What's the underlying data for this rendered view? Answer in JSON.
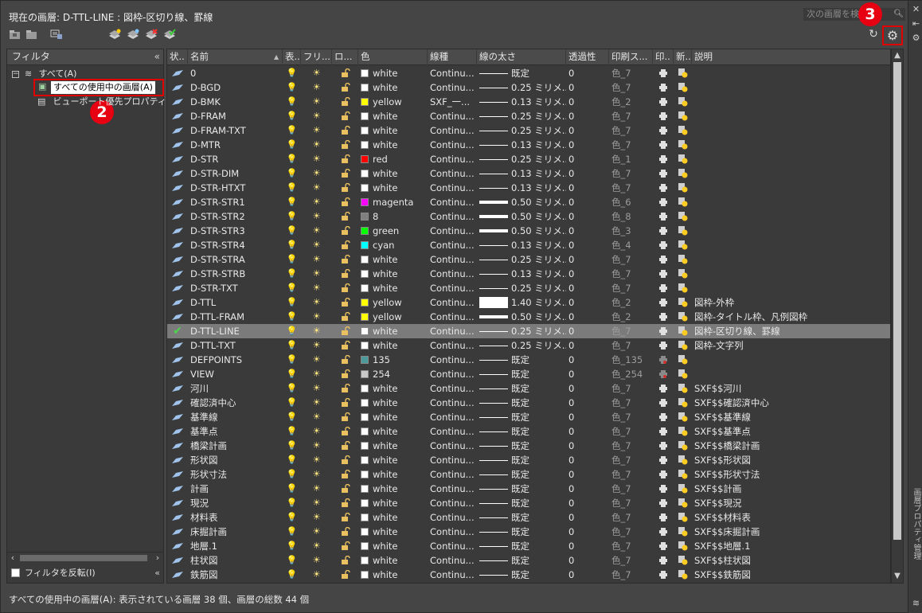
{
  "title": "現在の画層: D-TTL-LINE : 図枠-区切り線、罫線",
  "search_placeholder": "次の画層を検索",
  "callouts": {
    "two": "2",
    "three": "3"
  },
  "sidebar_strip_label": "画層プロパティ管理",
  "filter": {
    "header": "フィルタ",
    "tree": [
      {
        "label": "すべて(A)",
        "expander": "−"
      },
      {
        "label": "すべての使用中の画層(A)"
      },
      {
        "label": "ビューポート優先プロパティを含む画層"
      }
    ],
    "invert_label": "フィルタを反転(I)"
  },
  "columns": [
    "状..",
    "名前",
    "表..",
    "フリ...",
    "ロ...",
    "色",
    "線種",
    "線の太さ",
    "透過性",
    "印刷ス...",
    "印..",
    "新..",
    "説明"
  ],
  "sort_indicator": "▲",
  "colors": {
    "white": "#ffffff",
    "yellow": "#ffff00",
    "red": "#ff0000",
    "magenta": "#ff00ff",
    "8": "#808080",
    "green": "#00ff00",
    "cyan": "#00ffff",
    "135": "#4c9999",
    "254": "#c8c8c8"
  },
  "layers": [
    {
      "name": "0",
      "color": "white",
      "linetype": "Continu...",
      "lineweight": "既定",
      "lw": 1,
      "transparency": "0",
      "plotstyle": "色_7",
      "desc": ""
    },
    {
      "name": "D-BGD",
      "color": "white",
      "linetype": "Continu...",
      "lineweight": "0.25 ミリメ...",
      "lw": 1,
      "transparency": "0",
      "plotstyle": "色_7",
      "desc": ""
    },
    {
      "name": "D-BMK",
      "color": "yellow",
      "linetype": "SXF_一...",
      "lineweight": "0.13 ミリメ...",
      "lw": 1,
      "transparency": "0",
      "plotstyle": "色_2",
      "desc": ""
    },
    {
      "name": "D-FRAM",
      "color": "white",
      "linetype": "Continu...",
      "lineweight": "0.25 ミリメ...",
      "lw": 1,
      "transparency": "0",
      "plotstyle": "色_7",
      "desc": ""
    },
    {
      "name": "D-FRAM-TXT",
      "color": "white",
      "linetype": "Continu...",
      "lineweight": "0.25 ミリメ...",
      "lw": 1,
      "transparency": "0",
      "plotstyle": "色_7",
      "desc": ""
    },
    {
      "name": "D-MTR",
      "color": "white",
      "linetype": "Continu...",
      "lineweight": "0.13 ミリメ...",
      "lw": 1,
      "transparency": "0",
      "plotstyle": "色_7",
      "desc": ""
    },
    {
      "name": "D-STR",
      "color": "red",
      "linetype": "Continu...",
      "lineweight": "0.25 ミリメ...",
      "lw": 1,
      "transparency": "0",
      "plotstyle": "色_1",
      "desc": ""
    },
    {
      "name": "D-STR-DIM",
      "color": "white",
      "linetype": "Continu...",
      "lineweight": "0.13 ミリメ...",
      "lw": 1,
      "transparency": "0",
      "plotstyle": "色_7",
      "desc": ""
    },
    {
      "name": "D-STR-HTXT",
      "color": "white",
      "linetype": "Continu...",
      "lineweight": "0.13 ミリメ...",
      "lw": 1,
      "transparency": "0",
      "plotstyle": "色_7",
      "desc": ""
    },
    {
      "name": "D-STR-STR1",
      "color": "magenta",
      "linetype": "Continu...",
      "lineweight": "0.50 ミリメ...",
      "lw": 4,
      "transparency": "0",
      "plotstyle": "色_6",
      "desc": ""
    },
    {
      "name": "D-STR-STR2",
      "color": "8",
      "linetype": "Continu...",
      "lineweight": "0.50 ミリメ...",
      "lw": 4,
      "transparency": "0",
      "plotstyle": "色_8",
      "desc": ""
    },
    {
      "name": "D-STR-STR3",
      "color": "green",
      "linetype": "Continu...",
      "lineweight": "0.50 ミリメ...",
      "lw": 4,
      "transparency": "0",
      "plotstyle": "色_3",
      "desc": ""
    },
    {
      "name": "D-STR-STR4",
      "color": "cyan",
      "linetype": "Continu...",
      "lineweight": "0.13 ミリメ...",
      "lw": 1,
      "transparency": "0",
      "plotstyle": "色_4",
      "desc": ""
    },
    {
      "name": "D-STR-STRA",
      "color": "white",
      "linetype": "Continu...",
      "lineweight": "0.25 ミリメ...",
      "lw": 1,
      "transparency": "0",
      "plotstyle": "色_7",
      "desc": ""
    },
    {
      "name": "D-STR-STRB",
      "color": "white",
      "linetype": "Continu...",
      "lineweight": "0.13 ミリメ...",
      "lw": 1,
      "transparency": "0",
      "plotstyle": "色_7",
      "desc": ""
    },
    {
      "name": "D-STR-TXT",
      "color": "white",
      "linetype": "Continu...",
      "lineweight": "0.25 ミリメ...",
      "lw": 1,
      "transparency": "0",
      "plotstyle": "色_7",
      "desc": ""
    },
    {
      "name": "D-TTL",
      "color": "yellow",
      "linetype": "Continu...",
      "lineweight": "1.40 ミリメ...",
      "lw": 14,
      "transparency": "0",
      "plotstyle": "色_2",
      "desc": "図枠-外枠"
    },
    {
      "name": "D-TTL-FRAM",
      "color": "yellow",
      "linetype": "Continu...",
      "lineweight": "0.50 ミリメ...",
      "lw": 4,
      "transparency": "0",
      "plotstyle": "色_2",
      "desc": "図枠-タイトル枠、凡例図枠"
    },
    {
      "name": "D-TTL-LINE",
      "color": "white",
      "linetype": "Continu...",
      "lineweight": "0.25 ミリメ...",
      "lw": 1,
      "transparency": "0",
      "plotstyle": "色_7",
      "desc": "図枠-区切り線、罫線",
      "current": true
    },
    {
      "name": "D-TTL-TXT",
      "color": "white",
      "linetype": "Continu...",
      "lineweight": "0.25 ミリメ...",
      "lw": 1,
      "transparency": "0",
      "plotstyle": "色_7",
      "desc": "図枠-文字列"
    },
    {
      "name": "DEFPOINTS",
      "color": "135",
      "linetype": "Continu...",
      "lineweight": "既定",
      "lw": 1,
      "transparency": "0",
      "plotstyle": "色_135",
      "desc": "",
      "noplot": true
    },
    {
      "name": "VIEW",
      "color": "254",
      "linetype": "Continu...",
      "lineweight": "既定",
      "lw": 1,
      "transparency": "0",
      "plotstyle": "色_254",
      "desc": "",
      "noplot": true
    },
    {
      "name": "河川",
      "color": "white",
      "linetype": "Continu...",
      "lineweight": "既定",
      "lw": 1,
      "transparency": "0",
      "plotstyle": "色_7",
      "desc": "SXF$$河川"
    },
    {
      "name": "確認済中心",
      "color": "white",
      "linetype": "Continu...",
      "lineweight": "既定",
      "lw": 1,
      "transparency": "0",
      "plotstyle": "色_7",
      "desc": "SXF$$確認済中心"
    },
    {
      "name": "基準線",
      "color": "white",
      "linetype": "Continu...",
      "lineweight": "既定",
      "lw": 1,
      "transparency": "0",
      "plotstyle": "色_7",
      "desc": "SXF$$基準線"
    },
    {
      "name": "基準点",
      "color": "white",
      "linetype": "Continu...",
      "lineweight": "既定",
      "lw": 1,
      "transparency": "0",
      "plotstyle": "色_7",
      "desc": "SXF$$基準点"
    },
    {
      "name": "橋梁計画",
      "color": "white",
      "linetype": "Continu...",
      "lineweight": "既定",
      "lw": 1,
      "transparency": "0",
      "plotstyle": "色_7",
      "desc": "SXF$$橋梁計画"
    },
    {
      "name": "形状図",
      "color": "white",
      "linetype": "Continu...",
      "lineweight": "既定",
      "lw": 1,
      "transparency": "0",
      "plotstyle": "色_7",
      "desc": "SXF$$形状図"
    },
    {
      "name": "形状寸法",
      "color": "white",
      "linetype": "Continu...",
      "lineweight": "既定",
      "lw": 1,
      "transparency": "0",
      "plotstyle": "色_7",
      "desc": "SXF$$形状寸法"
    },
    {
      "name": "計画",
      "color": "white",
      "linetype": "Continu...",
      "lineweight": "既定",
      "lw": 1,
      "transparency": "0",
      "plotstyle": "色_7",
      "desc": "SXF$$計画"
    },
    {
      "name": "現況",
      "color": "white",
      "linetype": "Continu...",
      "lineweight": "既定",
      "lw": 1,
      "transparency": "0",
      "plotstyle": "色_7",
      "desc": "SXF$$現況"
    },
    {
      "name": "材料表",
      "color": "white",
      "linetype": "Continu...",
      "lineweight": "既定",
      "lw": 1,
      "transparency": "0",
      "plotstyle": "色_7",
      "desc": "SXF$$材料表"
    },
    {
      "name": "床掘計画",
      "color": "white",
      "linetype": "Continu...",
      "lineweight": "既定",
      "lw": 1,
      "transparency": "0",
      "plotstyle": "色_7",
      "desc": "SXF$$床掘計画"
    },
    {
      "name": "地層.1",
      "color": "white",
      "linetype": "Continu...",
      "lineweight": "既定",
      "lw": 1,
      "transparency": "0",
      "plotstyle": "色_7",
      "desc": "SXF$$地層.1"
    },
    {
      "name": "柱状図",
      "color": "white",
      "linetype": "Continu...",
      "lineweight": "既定",
      "lw": 1,
      "transparency": "0",
      "plotstyle": "色_7",
      "desc": "SXF$$柱状図"
    },
    {
      "name": "鉄筋図",
      "color": "white",
      "linetype": "Continu...",
      "lineweight": "既定",
      "lw": 1,
      "transparency": "0",
      "plotstyle": "色_7",
      "desc": "SXF$$鉄筋図"
    }
  ],
  "status": "すべての使用中の画層(A): 表示されている画層 38 個、画層の総数 44 個"
}
